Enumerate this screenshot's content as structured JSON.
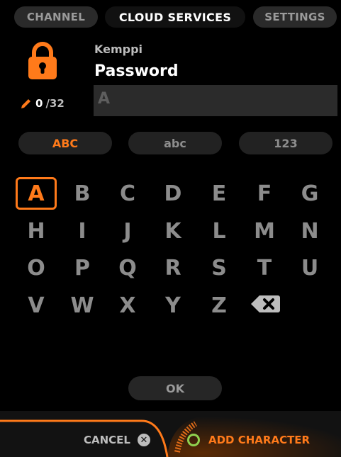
{
  "tabs": [
    {
      "label": "CHANNEL"
    },
    {
      "label": "CLOUD SERVICES"
    },
    {
      "label": "SETTINGS"
    }
  ],
  "header": {
    "subtitle": "Kemppi",
    "title": "Password"
  },
  "counter": {
    "current": "0",
    "max": "/32",
    "icon": "pencil-icon"
  },
  "password_field": {
    "value": "A"
  },
  "modes": [
    {
      "label": "ABC",
      "active": true
    },
    {
      "label": "abc",
      "active": false
    },
    {
      "label": "123",
      "active": false
    }
  ],
  "keys": [
    "A",
    "B",
    "C",
    "D",
    "E",
    "F",
    "G",
    "H",
    "I",
    "J",
    "K",
    "L",
    "M",
    "N",
    "O",
    "P",
    "Q",
    "R",
    "S",
    "T",
    "U",
    "V",
    "W",
    "X",
    "Y",
    "Z"
  ],
  "selected_key": "A",
  "ok_label": "OK",
  "footer": {
    "cancel_label": "CANCEL",
    "add_label": "ADD CHARACTER"
  },
  "colors": {
    "accent": "#ff7a1a",
    "ring": "#8fd14f"
  }
}
